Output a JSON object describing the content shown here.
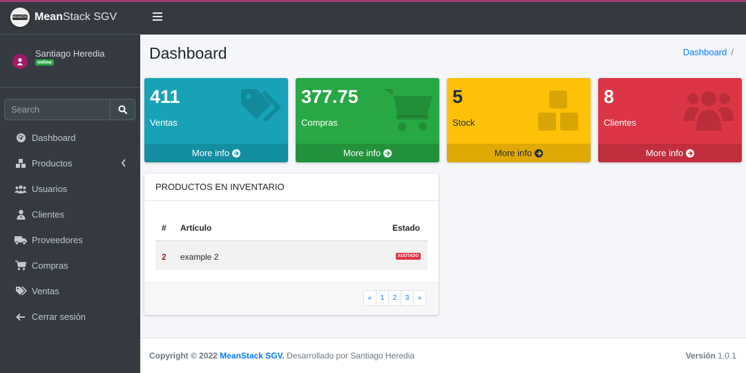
{
  "brand": {
    "name_bold": "Mean",
    "name_rest": "Stack SGV",
    "logo_text": "MEANSTACK"
  },
  "user": {
    "name": "Santiago Heredia",
    "status": "online"
  },
  "search": {
    "placeholder": "Search"
  },
  "nav": {
    "items": [
      {
        "label": "Dashboard",
        "icon": "dashboard-icon"
      },
      {
        "label": "Productos",
        "icon": "cubes-icon"
      },
      {
        "label": "Usuarios",
        "icon": "users-icon"
      },
      {
        "label": "Clientes",
        "icon": "user-tie-icon"
      },
      {
        "label": "Proveedores",
        "icon": "truck-icon"
      },
      {
        "label": "Compras",
        "icon": "cart-icon"
      },
      {
        "label": "Ventas",
        "icon": "tags-icon"
      },
      {
        "label": "Cerrar sesión",
        "icon": "arrow-left-icon"
      }
    ]
  },
  "page": {
    "title": "Dashboard",
    "breadcrumb": "Dashboard",
    "breadcrumb_sep": "/"
  },
  "boxes": [
    {
      "value": "411",
      "label": "Ventas",
      "link": "More info",
      "color": "#17a2b8",
      "icon": "tags-icon"
    },
    {
      "value": "377.75",
      "label": "Compras",
      "link": "More info",
      "color": "#28a745",
      "icon": "cart-icon"
    },
    {
      "value": "5",
      "label": "Stock",
      "link": "More info",
      "color": "#ffc107",
      "icon": "cubes-icon"
    },
    {
      "value": "8",
      "label": "Clientes",
      "link": "More info",
      "color": "#dc3545",
      "icon": "users-icon"
    }
  ],
  "inventory": {
    "title": "PRODUCTOS EN INVENTARIO",
    "headers": [
      "#",
      "Artículo",
      "Estado"
    ],
    "rows": [
      {
        "id": "2",
        "article": "example 2",
        "status": "AGOTADO"
      }
    ],
    "pager": [
      "«",
      "1",
      "2",
      "3",
      "»"
    ]
  },
  "footer": {
    "copyright": "Copyright © 2022",
    "brand": "MeanStack SGV.",
    "credit": "Desarrollado por Santiago Heredia",
    "version_label": "Versión",
    "version": "1.0.1"
  }
}
